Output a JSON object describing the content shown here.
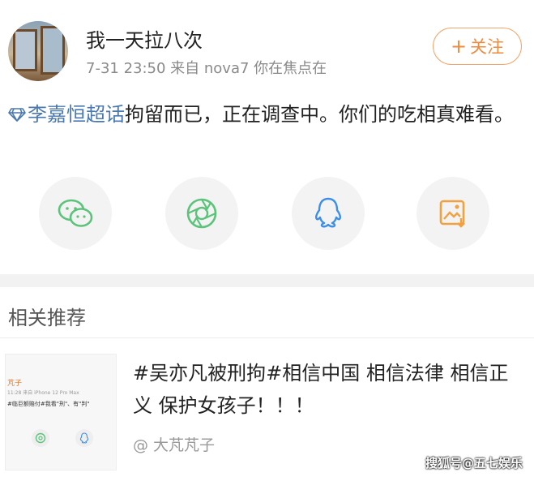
{
  "post": {
    "username": "我一天拉八次",
    "meta": "7-31 23:50  来自 nova7 你在焦点在",
    "follow_label": "关注",
    "topic": "李嘉恒超话",
    "body_text": "拘留而已，正在调查中。你们的吃相真难看。",
    "share_icons": [
      "wechat-icon",
      "moments-icon",
      "qq-icon",
      "save-image-icon"
    ]
  },
  "related": {
    "title": "相关推荐",
    "card": {
      "title": "#吴亦凡被刑拘#相信中国 相信法律 相信正义 保护女孩子！！！",
      "source": "@ 大芃芃子",
      "thumb_name": "芃子",
      "thumb_meta": "11:28  来自 iPhone 12 Pro Max",
      "thumb_text": "#临巨额赔付#我看\"刑\"、有\"判\""
    }
  },
  "watermark": "搜狐号@五七娱乐",
  "colors": {
    "accent_orange": "#f08a3c",
    "link_blue": "#4a78b0",
    "wechat_green": "#5cc47a",
    "qq_blue": "#3d8ee8",
    "save_orange": "#f2a13f"
  }
}
